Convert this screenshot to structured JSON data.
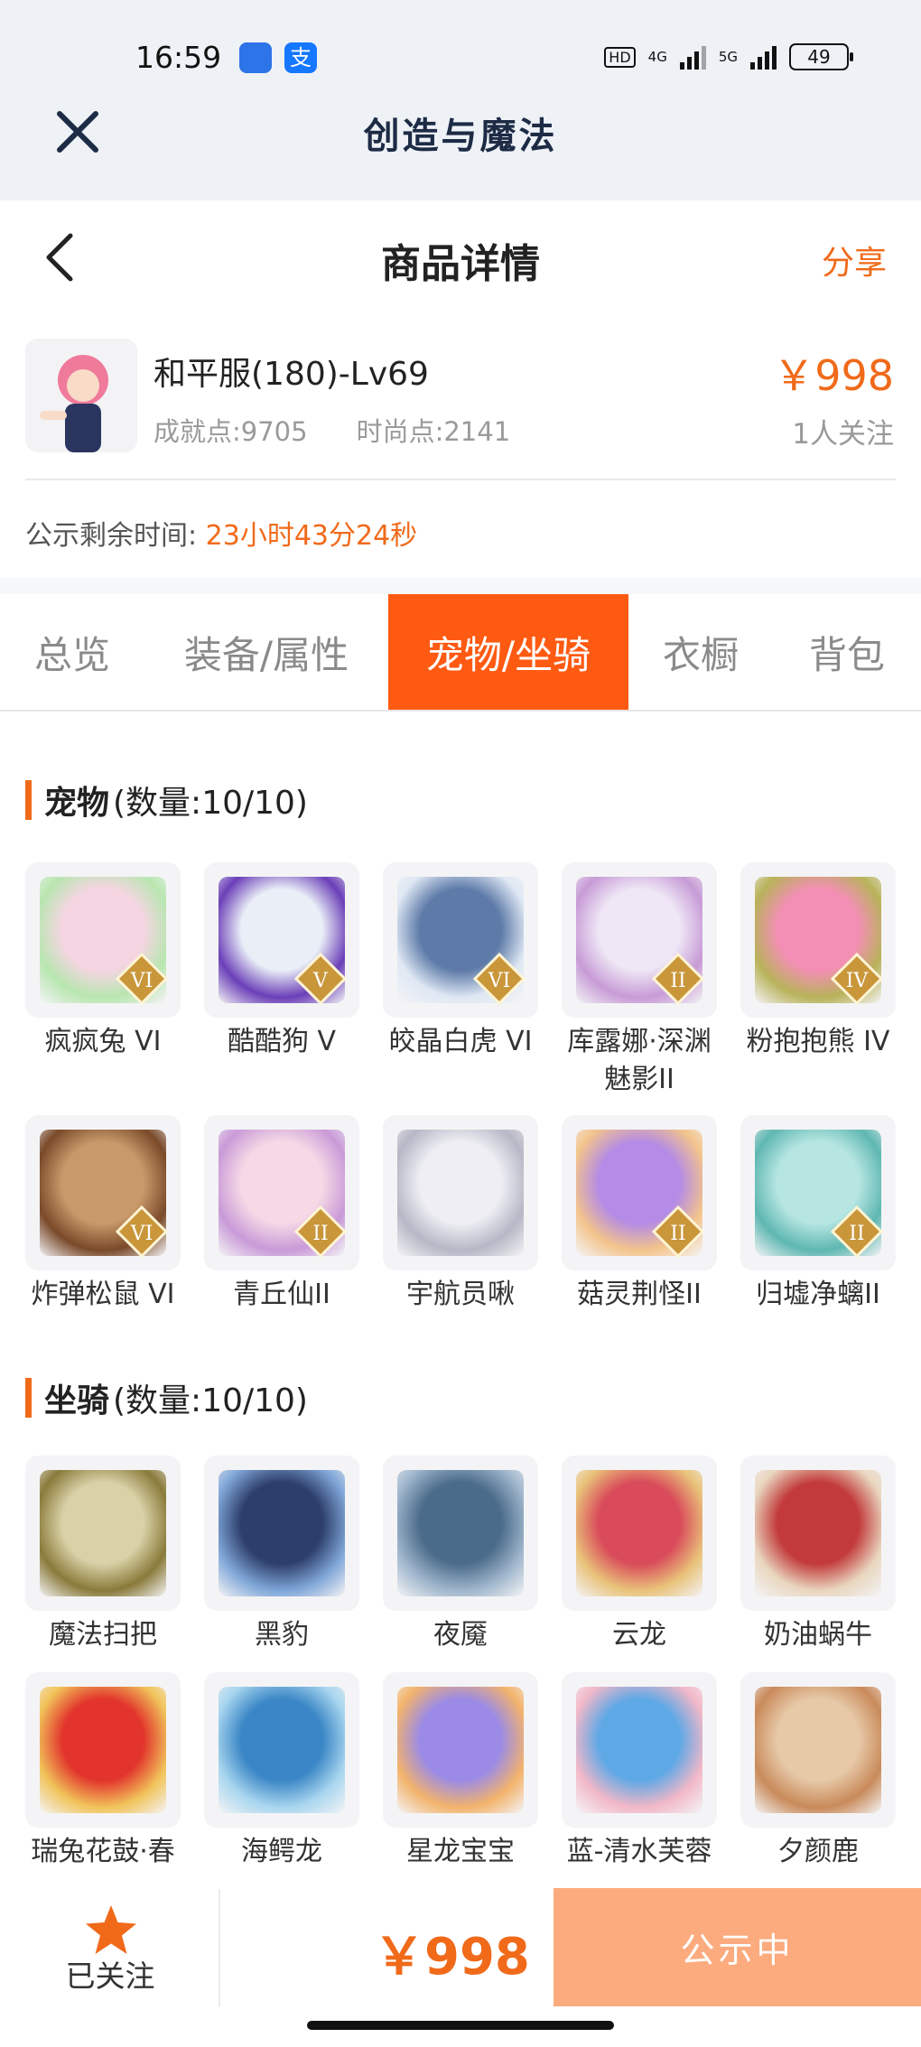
{
  "status": {
    "time": "16:59",
    "hd": "HD",
    "net1": "4G",
    "net2": "5G",
    "battery": "49"
  },
  "app_header": {
    "title": "创造与魔法"
  },
  "page_header": {
    "title": "商品详情",
    "share_label": "分享"
  },
  "product": {
    "name": "和平服(180)-Lv69",
    "achievement": "成就点:9705",
    "fashion": "时尚点:2141",
    "price": "￥998",
    "followers": "1人关注",
    "countdown_label": "公示剩余时间:",
    "countdown_value": "23小时43分24秒"
  },
  "tabs": [
    {
      "label": "总览",
      "active": false
    },
    {
      "label": "装备/属性",
      "active": false
    },
    {
      "label": "宠物/坐骑",
      "active": true
    },
    {
      "label": "衣橱",
      "active": false
    },
    {
      "label": "背包",
      "active": false
    }
  ],
  "pets": {
    "title": "宠物",
    "count": "(数量:10/10)",
    "items": [
      {
        "name": "疯疯兔 VI",
        "badge": "VI",
        "color": "#f6d5e3",
        "color2": "#b8e6b0"
      },
      {
        "name": "酷酷狗 V",
        "badge": "V",
        "color": "#e9eef7",
        "color2": "#6b3fb8"
      },
      {
        "name": "皎晶白虎 VI",
        "badge": "VI",
        "color": "#5d7aa8",
        "color2": "#dfe8f4"
      },
      {
        "name": "库露娜·深渊魅影II",
        "badge": "II",
        "color": "#efe6f6",
        "color2": "#c79bd6"
      },
      {
        "name": "粉抱抱熊 IV",
        "badge": "IV",
        "color": "#f38fb5",
        "color2": "#b8b25a"
      },
      {
        "name": "炸弹松鼠 VI",
        "badge": "VI",
        "color": "#c89a6a",
        "color2": "#7a4a2a"
      },
      {
        "name": "青丘仙II",
        "badge": "II",
        "color": "#f5d9e6",
        "color2": "#c99ad8"
      },
      {
        "name": "宇航员啾",
        "badge": "",
        "color": "#eeeef4",
        "color2": "#b7b7c6"
      },
      {
        "name": "菇灵荆怪II",
        "badge": "II",
        "color": "#b48be6",
        "color2": "#f3c48c"
      },
      {
        "name": "归墟净螭II",
        "badge": "II",
        "color": "#b7e6e2",
        "color2": "#5fb7b2"
      }
    ]
  },
  "mounts": {
    "title": "坐骑",
    "count": "(数量:10/10)",
    "items": [
      {
        "name": "魔法扫把",
        "badge": "",
        "color": "#d9d2a8",
        "color2": "#8a7a3a"
      },
      {
        "name": "黑豹",
        "badge": "",
        "color": "#2d3e6a",
        "color2": "#7fa6d8"
      },
      {
        "name": "夜魇",
        "badge": "",
        "color": "#4a6b8a",
        "color2": "#9fb6cc"
      },
      {
        "name": "云龙",
        "badge": "",
        "color": "#d94a5a",
        "color2": "#e9c27a"
      },
      {
        "name": "奶油蜗牛",
        "badge": "",
        "color": "#c23a3a",
        "color2": "#e9d6bf"
      },
      {
        "name": "瑞兔花鼓·春",
        "badge": "",
        "color": "#e2342c",
        "color2": "#f1c35a"
      },
      {
        "name": "海鳄龙",
        "badge": "",
        "color": "#3a86c6",
        "color2": "#a9d6ef"
      },
      {
        "name": "星龙宝宝",
        "badge": "",
        "color": "#9b8be6",
        "color2": "#f3b36c"
      },
      {
        "name": "蓝-清水芙蓉",
        "badge": "",
        "color": "#5fa8e6",
        "color2": "#f2b8c8"
      },
      {
        "name": "夕颜鹿",
        "badge": "",
        "color": "#e7c9a8",
        "color2": "#c98a5a"
      }
    ]
  },
  "bottom_bar": {
    "follow_label": "已关注",
    "price": "￥998",
    "cta_label": "公示中"
  },
  "colors": {
    "accent": "#f06a1a",
    "tab_active": "#ff5a12",
    "cta": "#fcab7e",
    "header_bg": "#eef2f7"
  }
}
